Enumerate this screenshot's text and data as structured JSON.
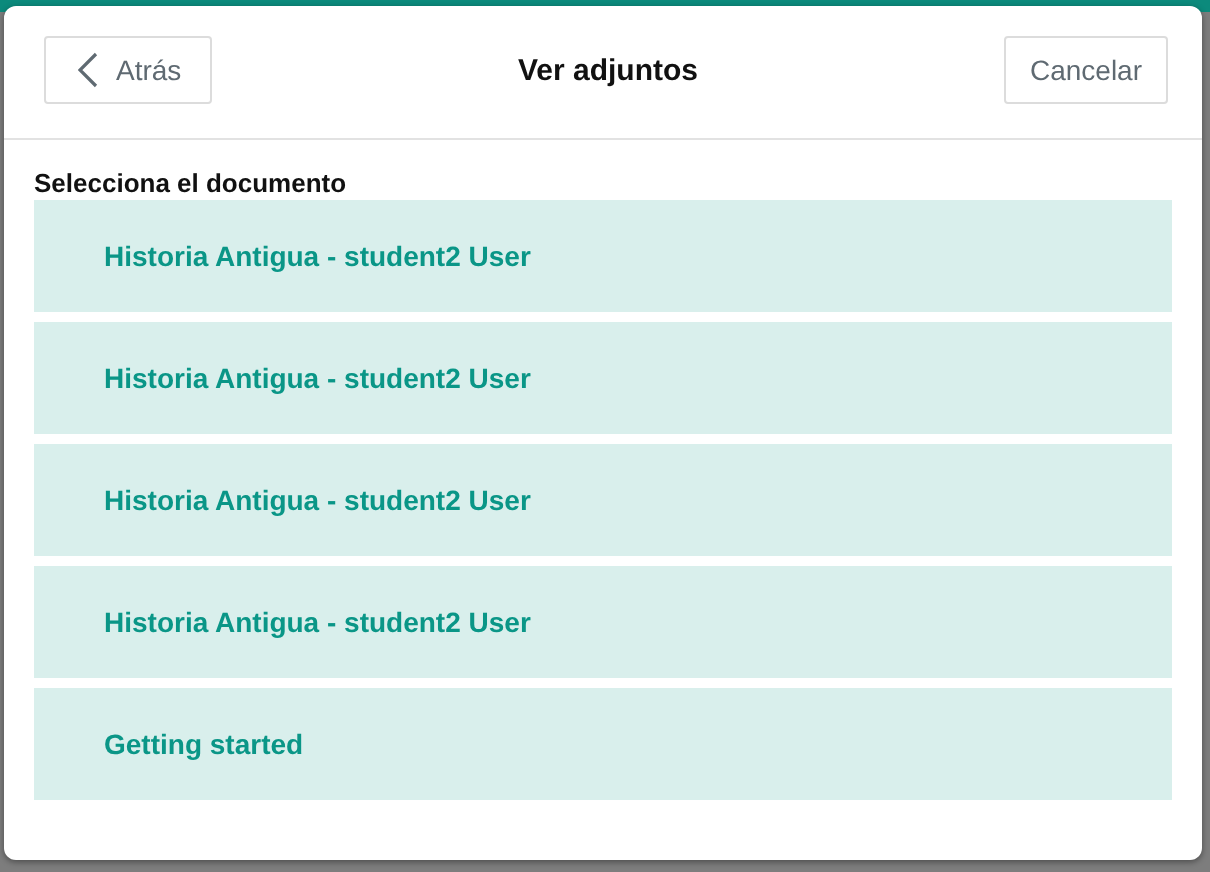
{
  "header": {
    "back_button": "Atrás",
    "title": "Ver adjuntos",
    "cancel_button": "Cancelar"
  },
  "section_label": "Selecciona el documento",
  "documents": [
    {
      "name": "Historia Antigua - student2 User"
    },
    {
      "name": "Historia Antigua - student2 User"
    },
    {
      "name": "Historia Antigua - student2 User"
    },
    {
      "name": "Historia Antigua - student2 User"
    },
    {
      "name": "Getting started"
    }
  ]
}
